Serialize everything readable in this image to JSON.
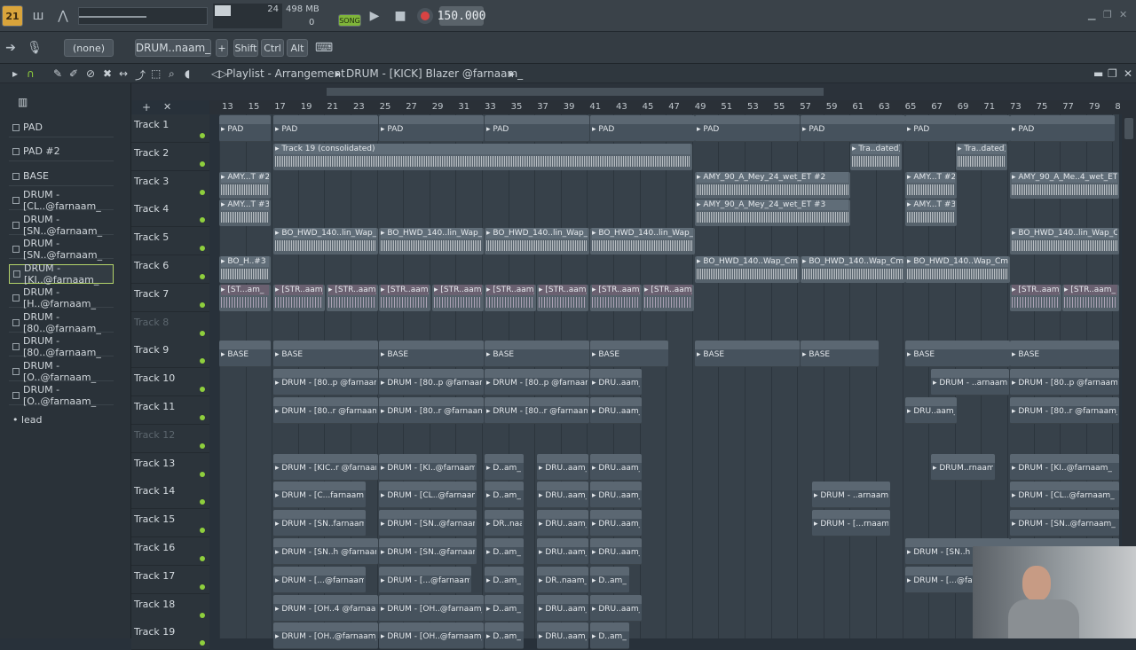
{
  "app": {
    "version_badge": "21",
    "cpu_value": "24",
    "memory": "498 MB",
    "memory_sub": "0",
    "song_label": "SONG",
    "tempo": "150.000",
    "pattern_preset": "(none)",
    "pattern_name": "DRUM..naam_",
    "keys": [
      "Shift",
      "Ctrl",
      "Alt"
    ]
  },
  "playlist": {
    "title": "Playlist - Arrangement",
    "breadcrumb": "DRUM - [KICK] Blazer @farnaam_"
  },
  "patterns": [
    "PAD",
    "PAD #2",
    "BASE",
    "DRUM - [CL..@farnaam_",
    "DRUM - [SN..@farnaam_",
    "DRUM - [SN..@farnaam_",
    "DRUM - [KI..@farnaam_",
    "DRUM - [H..@farnaam_",
    "DRUM - [80..@farnaam_",
    "DRUM - [80..@farnaam_",
    "DRUM - [O..@farnaam_",
    "DRUM - [O..@farnaam_"
  ],
  "lead_label": "• lead",
  "ruler": [
    "13",
    "15",
    "17",
    "19",
    "21",
    "23",
    "25",
    "27",
    "29",
    "31",
    "33",
    "35",
    "37",
    "39",
    "41",
    "43",
    "45",
    "47",
    "49",
    "51",
    "53",
    "55",
    "57",
    "59",
    "61",
    "63",
    "65",
    "67",
    "69",
    "71",
    "73",
    "75",
    "77",
    "79",
    "8"
  ],
  "tracks": [
    "Track 1",
    "Track 2",
    "Track 3",
    "Track 4",
    "Track 5",
    "Track 6",
    "Track 7",
    "Track 8",
    "Track 9",
    "Track 10",
    "Track 11",
    "Track 12",
    "Track 13",
    "Track 14",
    "Track 15",
    "Track 16",
    "Track 17",
    "Track 18",
    "Track 19"
  ],
  "clips": {
    "pad": "PAD",
    "pad2": "PAD #2",
    "t19": "Track 19 (consolidated)",
    "tra": "Tra..dated)",
    "amy1": "AMY...T #2",
    "amy2": "AMY...T #3",
    "amyw1": "AMY_90_A_Mey_24_wet_ET #2",
    "amyw2": "AMY_90_A_Mey_24_wet_ET #3",
    "amyr": "AMY_90_A_Me..4_wet_ET #2",
    "bo": "BO_HWD_140..lin_Wap_Cm",
    "boh": "BO_H..#3",
    "bow": "BO_HWD_140..Wap_Cm #3",
    "str": "[STR..aam_",
    "sta": "[ST...am_",
    "base": "BASE",
    "d80p": "DRUM - [80..p @farnaam_",
    "d80r": "DRUM - [80..r @farnaam_",
    "dru": "DRU..aam_",
    "darn": "DRUM - ..arnaam_",
    "drua": "DRU..aam_",
    "kic": "DRUM - [KIC..r @farnaam_",
    "ki": "DRUM - [KI..@farnaam_",
    "dam": "D..am_",
    "drumr": "DRUM..rnaam_",
    "cf": "DRUM - [C...farnaam_",
    "cl": "DRUM - [CL..@farnaam_",
    "darn2": "DRUM - ..arnaam_",
    "snf": "DRUM - [SN..farnaam_",
    "sn": "DRUM - [SN..@farnaam_",
    "drn": "DR..naam_",
    "drn2": "DRUM - [...rnaam_",
    "snh": "DRUM - [SN..h @farnaam_",
    "dots": "DRUM - [...@farnaam_",
    "drnaam": "DR..naam_",
    "dfarn": "DRUM - [...@farn",
    "oh4": "DRUM - [OH..4 @farnaam_",
    "oh": "DRUM - [OH..@farnaam_"
  },
  "colors": {
    "accent": "#8fcf3d",
    "record": "#d94343",
    "clip_pattern": "#5b6772"
  }
}
